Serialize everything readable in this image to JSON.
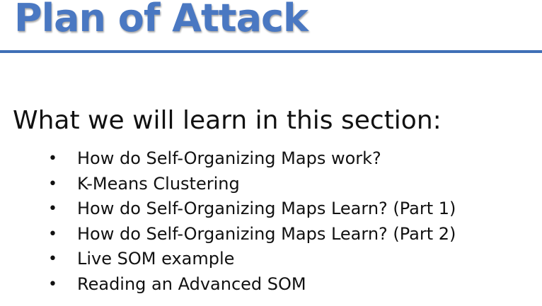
{
  "slide": {
    "title": "Plan of Attack",
    "heading": "What we will learn in this section:",
    "bullet_glyph": "•",
    "topics": [
      "How do Self-Organizing Maps work?",
      "K-Means Clustering",
      "How do Self-Organizing Maps Learn? (Part 1)",
      "How do Self-Organizing Maps Learn? (Part 2)",
      "Live SOM example",
      "Reading an Advanced SOM"
    ]
  },
  "colors": {
    "title": "#4a78c2",
    "rule": "#3f6fb6",
    "text": "#111111",
    "background": "#ffffff"
  }
}
